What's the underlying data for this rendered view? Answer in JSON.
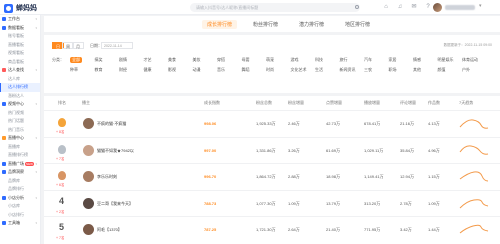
{
  "header": {
    "logo_text": "蝉妈妈",
    "search_placeholder": "请输入抖音号/达人昵称/直播间标题",
    "icons": [
      "home-icon",
      "bell-icon",
      "message-icon",
      "help-icon"
    ]
  },
  "sidebar": {
    "rows": [
      {
        "type": "group",
        "label": "工作台",
        "color": "blue"
      },
      {
        "type": "group",
        "label": "数据看板",
        "color": "blue"
      },
      {
        "type": "item",
        "label": "账号看板"
      },
      {
        "type": "item",
        "label": "直播看板"
      },
      {
        "type": "item",
        "label": "视频看板"
      },
      {
        "type": "item",
        "label": "商品看板"
      },
      {
        "type": "group",
        "label": "达人查找",
        "color": "red"
      },
      {
        "type": "item",
        "label": "达人库"
      },
      {
        "type": "item",
        "label": "达人排行榜",
        "active": true
      },
      {
        "type": "item",
        "label": "涨粉达人"
      },
      {
        "type": "group",
        "label": "视频中心",
        "color": "blue"
      },
      {
        "type": "item",
        "label": "热门视频"
      },
      {
        "type": "item",
        "label": "热门话题"
      },
      {
        "type": "item",
        "label": "热门音乐"
      },
      {
        "type": "group",
        "label": "直播中心",
        "color": "orange"
      },
      {
        "type": "item",
        "label": "直播库"
      },
      {
        "type": "item",
        "label": "直播排行榜"
      },
      {
        "type": "group",
        "label": "直播广场",
        "color": "blue",
        "badge": "NEW"
      },
      {
        "type": "group",
        "label": "品牌洞察",
        "color": "blue"
      },
      {
        "type": "item",
        "label": "品牌库"
      },
      {
        "type": "item",
        "label": "品牌排行"
      },
      {
        "type": "group",
        "label": "小店分析",
        "color": "blue"
      },
      {
        "type": "item",
        "label": "小店库"
      },
      {
        "type": "item",
        "label": "小店排行"
      },
      {
        "type": "group",
        "label": "工具箱",
        "color": "blue"
      }
    ]
  },
  "tabs": [
    {
      "label": "成长排行榜",
      "active": true
    },
    {
      "label": "粉丝排行榜"
    },
    {
      "label": "潜力排行榜"
    },
    {
      "label": "地区排行榜"
    }
  ],
  "filters": {
    "period_label": "日榜",
    "periods": [
      {
        "label": "日",
        "on": true
      },
      {
        "label": "周"
      },
      {
        "label": "月"
      }
    ],
    "date_label": "日期：",
    "date_value": "2022-11-14",
    "update_text": "数据更新于：2022-11-15 09:00",
    "category_label": "分类：",
    "categories_row1": [
      {
        "label": "全部",
        "on": true
      },
      {
        "label": "搞笑"
      },
      {
        "label": "剧情"
      },
      {
        "label": "才艺"
      },
      {
        "label": "美食"
      },
      {
        "label": "美妆"
      },
      {
        "label": "穿搭"
      },
      {
        "label": "母婴"
      },
      {
        "label": "萌宠"
      },
      {
        "label": "游戏"
      },
      {
        "label": "科技"
      },
      {
        "label": "旅行"
      },
      {
        "label": "汽车"
      },
      {
        "label": "家居"
      },
      {
        "label": "情感"
      },
      {
        "label": "明星娱乐"
      },
      {
        "label": "体育运动"
      }
    ],
    "categories_row2": [
      {
        "label": "种草"
      },
      {
        "label": "教育"
      },
      {
        "label": "财经"
      },
      {
        "label": "健康"
      },
      {
        "label": "影视"
      },
      {
        "label": "动漫"
      },
      {
        "label": "音乐"
      },
      {
        "label": "舞蹈"
      },
      {
        "label": "时尚"
      },
      {
        "label": "文化艺术"
      },
      {
        "label": "生活"
      },
      {
        "label": "新闻资讯"
      },
      {
        "label": "三农"
      },
      {
        "label": "职场"
      },
      {
        "label": "其他"
      },
      {
        "label": "颜值"
      },
      {
        "label": "户外"
      }
    ]
  },
  "table": {
    "headers": [
      "排名",
      "播主",
      "成长指数",
      "粉丝总数",
      "粉丝增量",
      "点赞增量",
      "播放增量",
      "评论增量",
      "作品数",
      "评论增量",
      "7天趋势"
    ],
    "rows": [
      {
        "rank": "1",
        "medal": "gold",
        "change": "+ 8名",
        "dir": "up",
        "name": "不疯的猫·不疯猫",
        "score": "998.06",
        "fans": "1,925.33万",
        "fans_inc": "2.46万",
        "likes": "42.73万",
        "plays": "678.41万",
        "comments": "21.16万",
        "works": "4.13万",
        "avatar": "#8c6a54"
      },
      {
        "rank": "2",
        "medal": "silver",
        "change": "+ 7名",
        "dir": "up",
        "name": "猫猫不如我★7942以",
        "score": "997.00",
        "fans": "1,331.86万",
        "fans_inc": "3.26万",
        "likes": "61.69万",
        "plays": "1,029.11万",
        "comments": "35.84万",
        "works": "4.96万",
        "avatar": "#c8a18a"
      },
      {
        "rank": "3",
        "medal": "bronze",
        "change": "+ 6名",
        "dir": "up",
        "name": "李乐乐时刻",
        "score": "996.70",
        "fans": "1,864.72万",
        "fans_inc": "2.88万",
        "likes": "18.98万",
        "plays": "1,149.41万",
        "comments": "12.94万",
        "works": "1.15万",
        "avatar": "#a77c62"
      },
      {
        "rank": "4",
        "medal": "",
        "change": "+ 2名",
        "dir": "up",
        "name": "豆二哥【我来今天】",
        "score": "788.73",
        "fans": "1,077.30万",
        "fans_inc": "1.09万",
        "likes": "13.79万",
        "plays": "313.20万",
        "comments": "2.78万",
        "works": "1.09万",
        "avatar": "#5a4a44"
      },
      {
        "rank": "5",
        "medal": "",
        "change": "+ 7名",
        "dir": "up",
        "name": "阿毛【1370】",
        "score": "787.25",
        "fans": "1,721.30万",
        "fans_inc": "2.64万",
        "likes": "21.40万",
        "plays": "771.95万",
        "comments": "3.42万",
        "works": "1.44万",
        "avatar": "#7b5a48"
      }
    ]
  }
}
